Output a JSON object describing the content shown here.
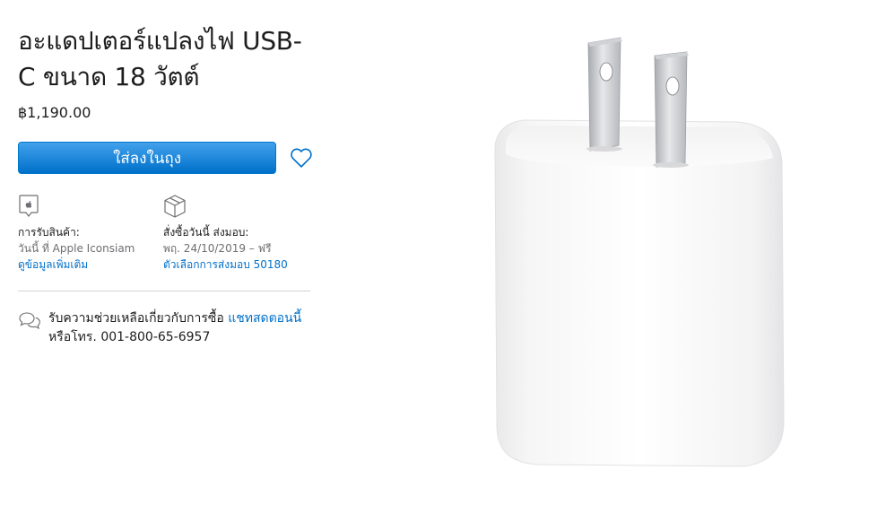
{
  "product": {
    "title": "อะแดปเตอร์แปลงไฟ USB-C ขนาด 18 วัตต์",
    "price": "฿1,190.00"
  },
  "actions": {
    "add_to_bag_label": "ใส่ลงในถุง"
  },
  "pickup": {
    "label": "การรับสินค้า:",
    "detail": "วันนี้ ที่ Apple Iconsiam",
    "link": "ดูข้อมูลเพิ่มเติม"
  },
  "delivery": {
    "label": "สั่งซื้อวันนี้ ส่งมอบ:",
    "detail": "พฤ. 24/10/2019 – ฟรี",
    "link": "ตัวเลือกการส่งมอบ 50180"
  },
  "help": {
    "text": "รับความช่วยเหลือเกี่ยวกับการซื้อ",
    "chat_link": "แชทสดตอนนี้",
    "phone_text": "หรือโทร. 001-800-65-6957"
  },
  "colors": {
    "accent": "#0070c9",
    "text": "#1d1d1f",
    "secondary": "#6e6e73"
  },
  "icons": [
    "heart-icon",
    "apple-store-icon",
    "box-icon",
    "chat-icon"
  ]
}
